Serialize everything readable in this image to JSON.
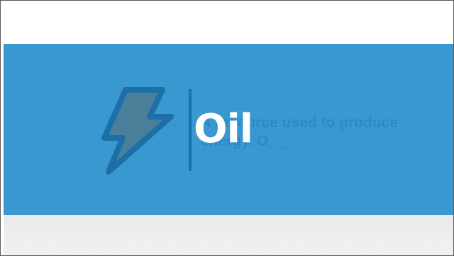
{
  "slide": {
    "clue_text": "A resource used to produce\nenergy. O_ _",
    "answer_word": "Oil"
  },
  "icons": {
    "main_icon": "lightning-bolt-icon"
  },
  "colors": {
    "band": "#3a98d1",
    "icon_fill": "#4a7f99",
    "icon_stroke": "#1c6fa8",
    "clue_text": "#2d88c7",
    "answer_text": "#ffffff",
    "footer": "#eeeeee"
  }
}
